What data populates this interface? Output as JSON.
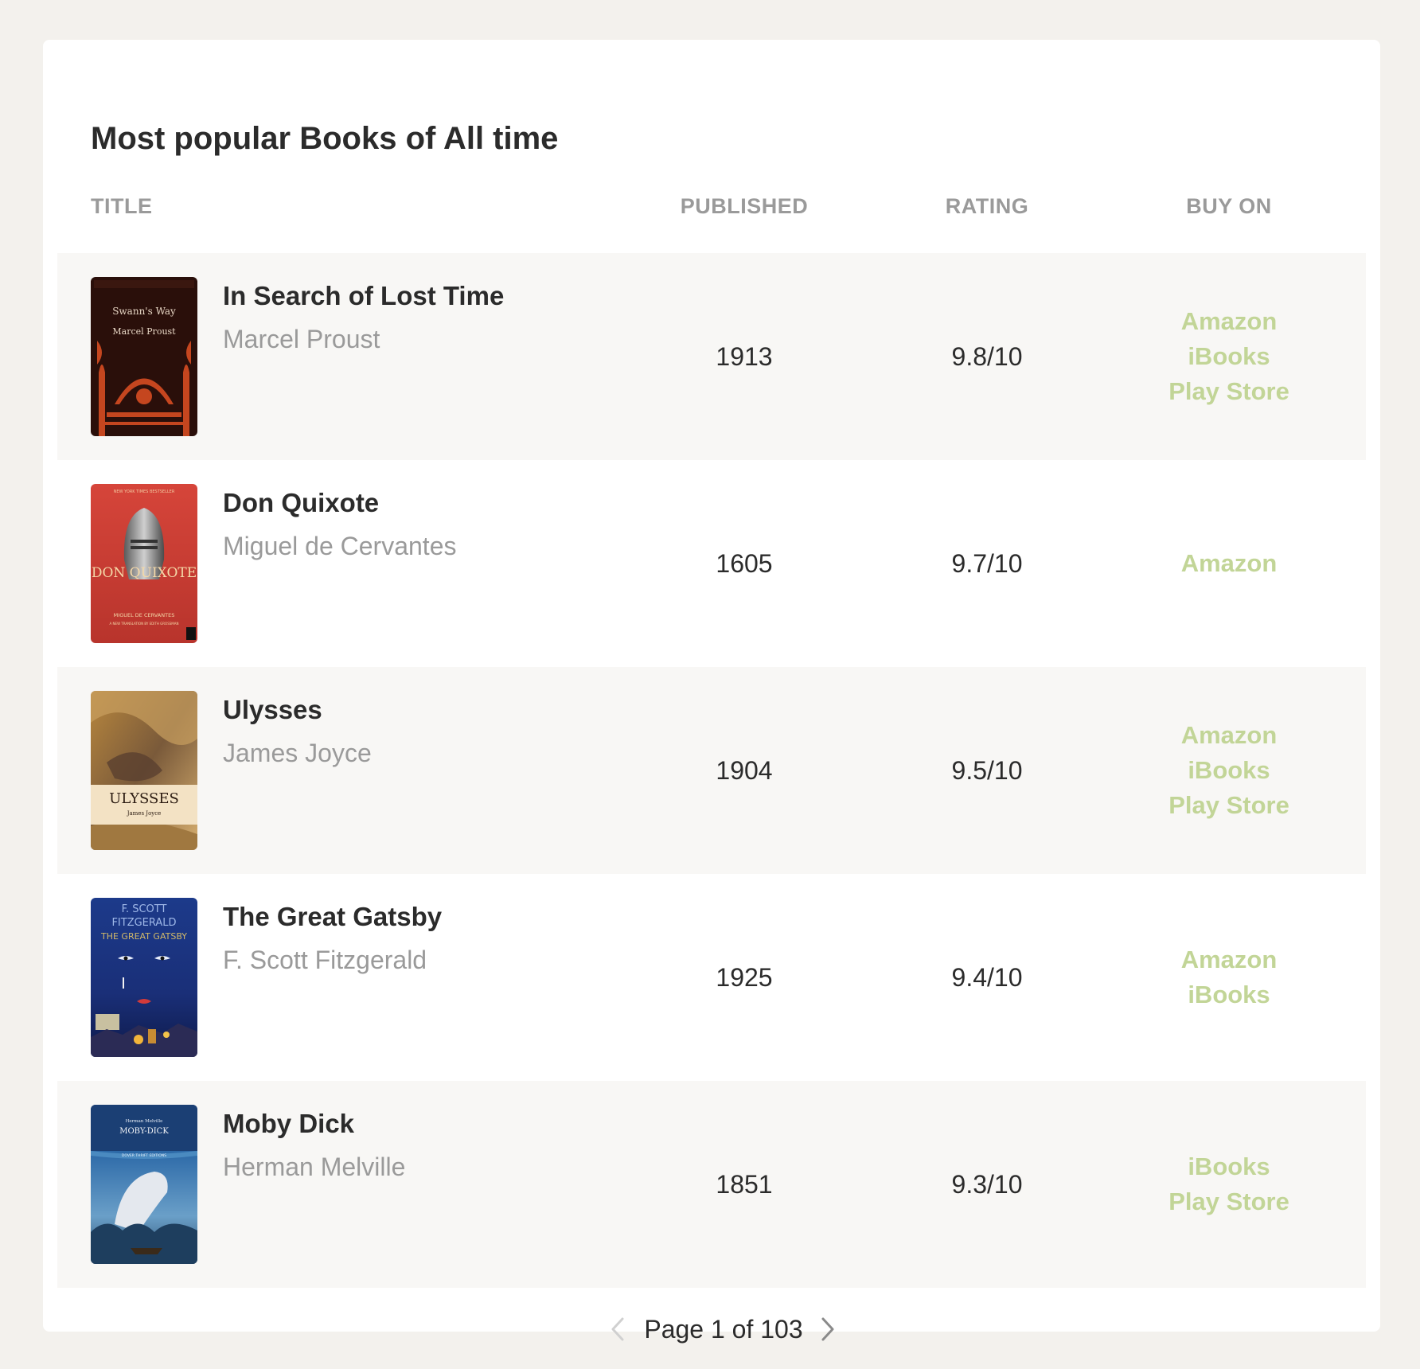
{
  "page": {
    "title": "Most popular Books of All time"
  },
  "table": {
    "headers": {
      "title": "TITLE",
      "published": "PUBLISHED",
      "rating": "RATING",
      "buy_on": "BUY ON"
    },
    "rows": [
      {
        "title": "In Search of Lost Time",
        "author": "Marcel Proust",
        "published": "1913",
        "rating": "9.8/10",
        "stores": [
          "Amazon",
          "iBooks",
          "Play Store"
        ],
        "cover": {
          "line1": "Swann's Way",
          "line2": "Marcel Proust"
        }
      },
      {
        "title": "Don Quixote",
        "author": "Miguel de Cervantes",
        "published": "1605",
        "rating": "9.7/10",
        "stores": [
          "Amazon"
        ],
        "cover": {
          "top": "NEW YORK TIMES BESTSELLER",
          "line1": "DON QUIXOTE",
          "line2": "MIGUEL DE CERVANTES",
          "line3": "A NEW TRANSLATION BY EDITH GROSSMAN"
        }
      },
      {
        "title": "Ulysses",
        "author": "James Joyce",
        "published": "1904",
        "rating": "9.5/10",
        "stores": [
          "Amazon",
          "iBooks",
          "Play Store"
        ],
        "cover": {
          "line1": "ULYSSES",
          "line2": "James Joyce"
        }
      },
      {
        "title": "The Great Gatsby",
        "author": "F. Scott Fitzgerald",
        "published": "1925",
        "rating": "9.4/10",
        "stores": [
          "Amazon",
          "iBooks"
        ],
        "cover": {
          "line1": "F. SCOTT",
          "line2": "FITZGERALD",
          "line3": "THE GREAT GATSBY"
        }
      },
      {
        "title": "Moby Dick",
        "author": "Herman Melville",
        "published": "1851",
        "rating": "9.3/10",
        "stores": [
          "iBooks",
          "Play Store"
        ],
        "cover": {
          "line1": "Herman Melville",
          "line2": "MOBY-DICK",
          "line3": "DOVER THRIFT EDITIONS"
        }
      }
    ]
  },
  "pagination": {
    "text": "Page 1 of 103",
    "prev_icon": "chevron-left-icon",
    "next_icon": "chevron-right-icon"
  },
  "colors": {
    "background": "#f3f1ed",
    "card": "#ffffff",
    "row_shade": "#f8f7f5",
    "link": "#c2d597",
    "muted": "#9a9a9a",
    "text": "#2b2b2b"
  }
}
